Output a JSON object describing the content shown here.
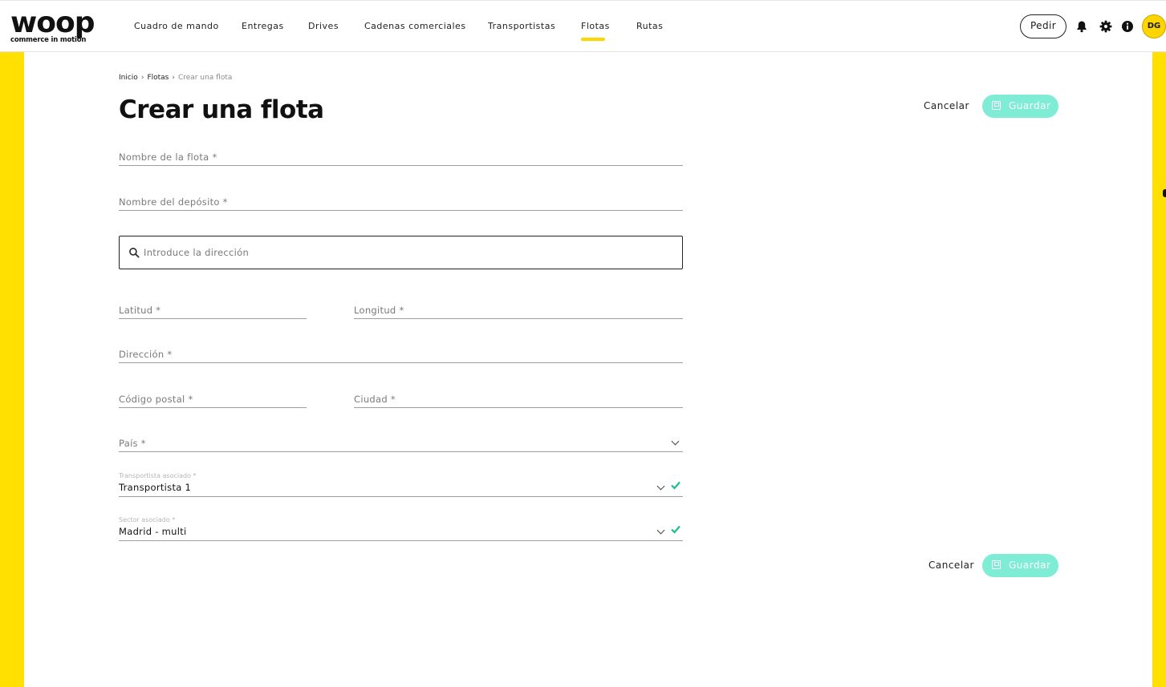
{
  "brand": {
    "logo_word": "woop",
    "logo_tagline": "commerce in motion"
  },
  "nav": {
    "items": [
      {
        "label": "Cuadro de mando"
      },
      {
        "label": "Entregas"
      },
      {
        "label": "Drives"
      },
      {
        "label": "Cadenas comerciales"
      },
      {
        "label": "Transportistas"
      },
      {
        "label": "Flotas",
        "active": true
      },
      {
        "label": "Rutas"
      }
    ]
  },
  "header_actions": {
    "order_label": "Pedir",
    "icons": [
      "bell-icon",
      "gear-icon",
      "info-icon"
    ],
    "avatar_initials": "DG"
  },
  "breadcrumb": {
    "home": "Inicio",
    "section": "Flotas",
    "current": "Crear una flota"
  },
  "page": {
    "title": "Crear una flota"
  },
  "actions": {
    "cancel_label": "Cancelar",
    "save_label": "Guardar"
  },
  "form": {
    "fleet_name": {
      "placeholder": "Nombre de la flota *"
    },
    "depot_name": {
      "placeholder": "Nombre del depósito *"
    },
    "address_search": {
      "placeholder": "Introduce la dirección"
    },
    "latitude": {
      "placeholder": "Latitud *"
    },
    "longitude": {
      "placeholder": "Longitud *"
    },
    "address": {
      "placeholder": "Dirección *"
    },
    "postal_code": {
      "placeholder": "Código postal *"
    },
    "city": {
      "placeholder": "Ciudad *"
    },
    "country": {
      "placeholder": "País *"
    },
    "carrier": {
      "label": "Transportista asociado *",
      "value": "Transportista 1"
    },
    "sector": {
      "label": "Sector asociado *",
      "value": "Madrid - multi"
    }
  },
  "colors": {
    "accent_yellow": "#FFE000",
    "save_button": "#7FEDD6",
    "check_green": "#1BBE8F"
  }
}
